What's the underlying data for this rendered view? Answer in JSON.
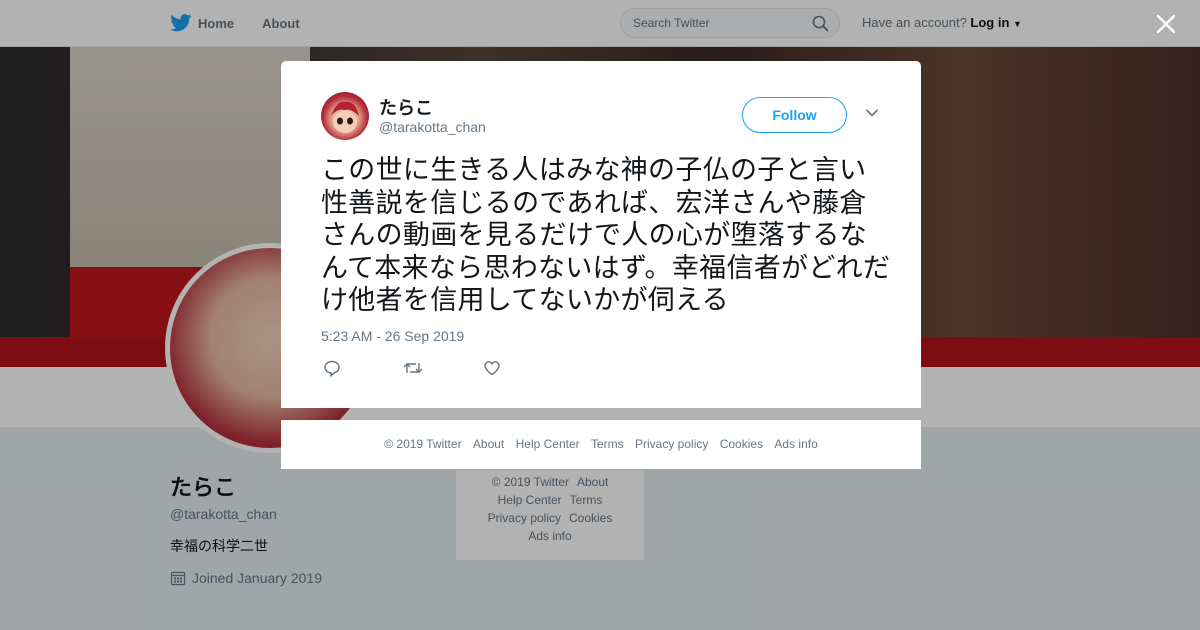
{
  "nav": {
    "home_label": "Home",
    "about_label": "About",
    "search_placeholder": "Search Twitter",
    "account_prompt": "Have an account?",
    "login_label": "Log in"
  },
  "profile": {
    "name": "たらこ",
    "handle": "@tarakotta_chan",
    "bio": "幸福の科学二世",
    "joined": "Joined January 2019"
  },
  "side_footer": {
    "line1": [
      "© 2019 Twitter",
      "About"
    ],
    "line2": [
      "Help Center",
      "Terms"
    ],
    "line3": [
      "Privacy policy",
      "Cookies"
    ],
    "line4": [
      "Ads info"
    ]
  },
  "tweet": {
    "name": "たらこ",
    "handle": "@tarakotta_chan",
    "follow_label": "Follow",
    "text": "この世に生きる人はみな神の子仏の子と言い性善説を信じるのであれば、宏洋さんや藤倉さんの動画を見るだけで人の心が堕落するなんて本来なら思わないはず。幸福信者がどれだけ他者を信用してないかが伺える",
    "timestamp": "5:23 AM - 26 Sep 2019"
  },
  "footer": {
    "items": [
      "© 2019 Twitter",
      "About",
      "Help Center",
      "Terms",
      "Privacy policy",
      "Cookies",
      "Ads info"
    ]
  },
  "colors": {
    "accent": "#1da1f2",
    "text": "#14171a",
    "muted": "#657786"
  }
}
